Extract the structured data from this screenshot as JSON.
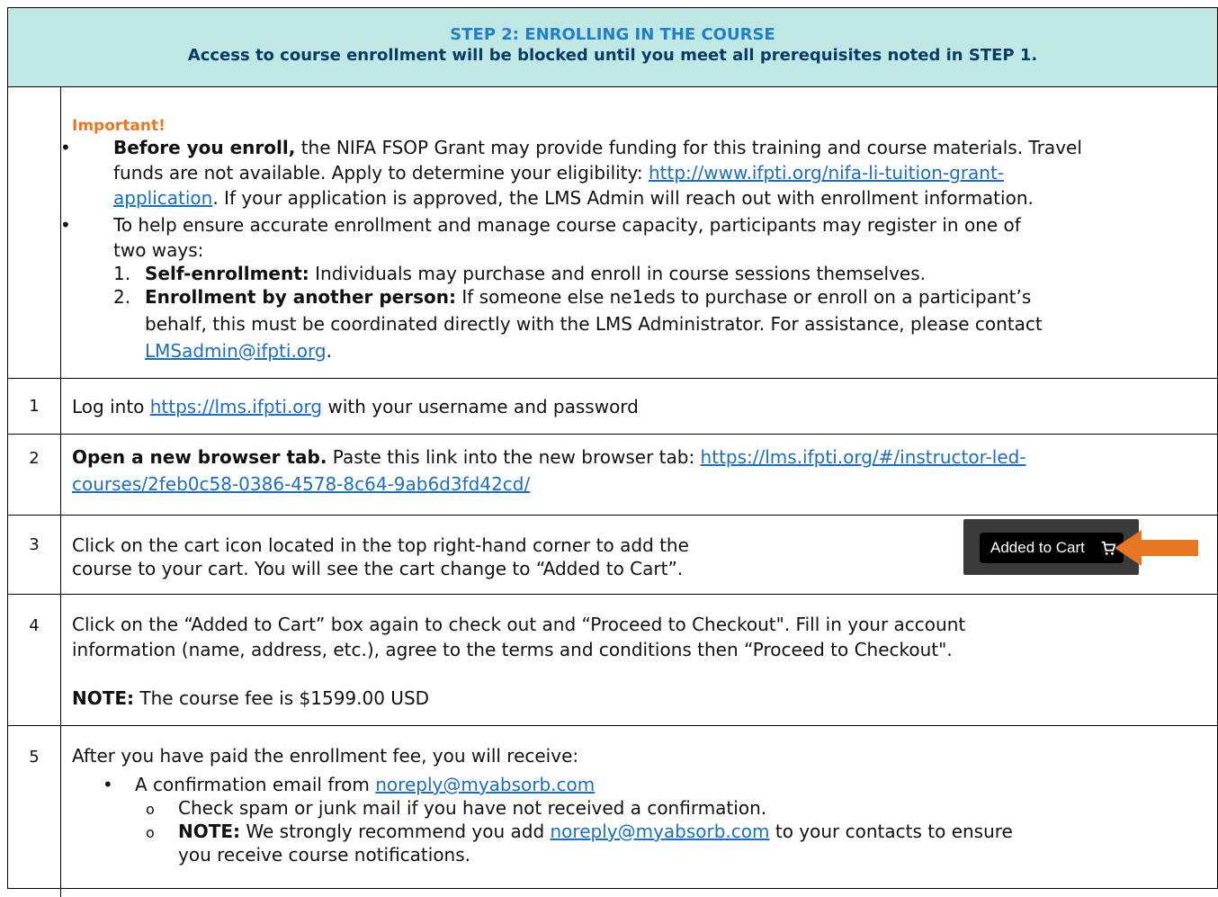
{
  "header": {
    "title": "STEP 2: ENROLLING IN THE COURSE",
    "subtitle": "Access to course enrollment will be blocked until you meet all prerequisites noted in STEP 1."
  },
  "important": {
    "label": "Important!",
    "b1_bold": "Before you enroll,",
    "b1_l1": " the NIFA FSOP Grant may provide funding for this training and course materials. Travel",
    "b1_l2a": "funds are not available. Apply to determine your eligibility: ",
    "b1_link_a": "http://www.ifpti.org/nifa-li-tuition-grant-",
    "b1_link_b": "application",
    "b1_l3": ". If your application is approved, the LMS Admin will reach out with enrollment information.",
    "b2_l1": "To help ensure accurate enrollment and manage course capacity, participants may register in one of",
    "b2_l2": "two ways:",
    "n1_num": "1.",
    "n1_bold": "Self-enrollment:",
    "n1_text": " Individuals may purchase and enroll in course sessions themselves.",
    "n2_num": "2.",
    "n2_bold": "Enrollment by another person:",
    "n2_l1": " If someone else ne1eds to purchase or enroll on a participant’s",
    "n2_l2": "behalf, this must be coordinated directly with the LMS Administrator. For assistance, please contact",
    "n2_link": "LMSadmin@ifpti.org",
    "n2_end": "."
  },
  "steps": {
    "s1": {
      "num": "1",
      "pre": "Log into ",
      "link": "https://lms.ifpti.org",
      "post": " with your username and password"
    },
    "s2": {
      "num": "2",
      "bold": "Open a new browser tab.",
      "text": " Paste this link into the new browser tab: ",
      "link_a": "https://lms.ifpti.org/#/instructor-led-",
      "link_b": "courses/2feb0c58-0386-4578-8c64-9ab6d3fd42cd/"
    },
    "s3": {
      "num": "3",
      "l1": "Click on the cart icon located in the top right-hand corner to add the",
      "l2": "course to your cart. You will see the cart change to “Added to Cart”.",
      "cart_label": "Added to Cart"
    },
    "s4": {
      "num": "4",
      "l1": "Click on the “Added to Cart” box again to check out and “Proceed to Checkout\". Fill in your account",
      "l2": "information (name, address, etc.), agree to the terms and conditions then “Proceed to Checkout\".",
      "note_bold": "NOTE:",
      "note_text": " The course fee is $1599.00 USD"
    },
    "s5": {
      "num": "5",
      "intro": "After you have paid the enrollment fee, you will receive:",
      "b1_pre": "A confirmation email from ",
      "b1_link": "noreply@myabsorb.com",
      "o1": "Check spam or junk mail if you have not received a confirmation.",
      "o2_bold": "NOTE:",
      "o2_pre": " We strongly recommend you add ",
      "o2_link": "noreply@myabsorb.com",
      "o2_post": " to your contacts to ensure",
      "o2_l2": "you receive course notifications."
    }
  },
  "colors": {
    "header_bg": "#bfe8e4",
    "title": "#1f7fc8",
    "link": "#1b6ec2",
    "accent": "#e87722"
  }
}
